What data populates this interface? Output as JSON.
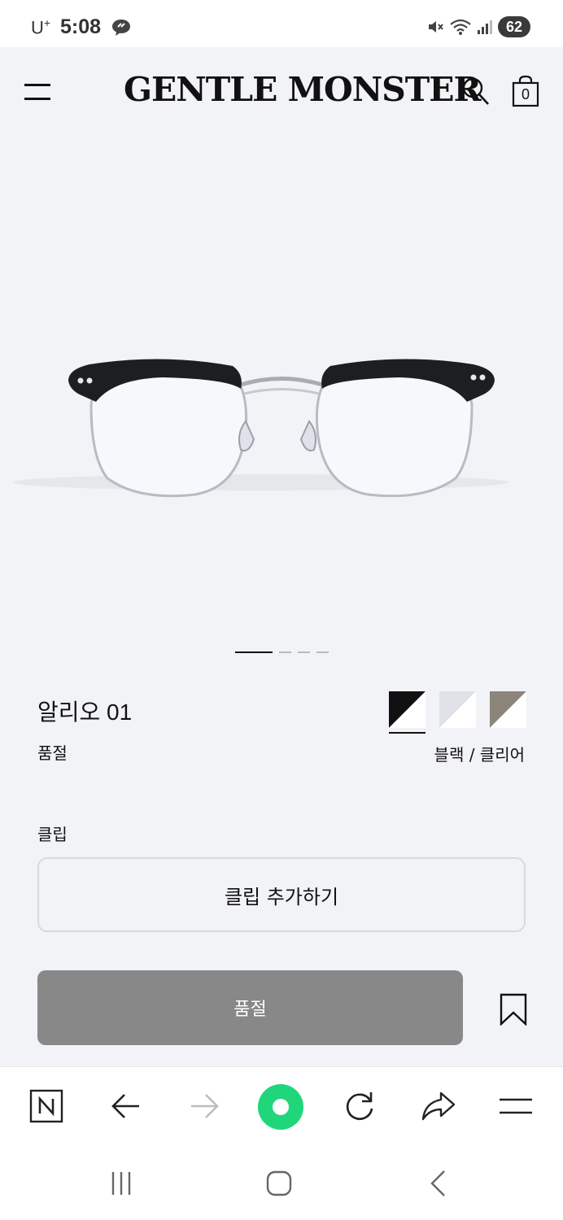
{
  "status_bar": {
    "carrier": "U",
    "carrier_sup": "+",
    "time": "5:08",
    "battery": "62"
  },
  "header": {
    "logo": "GENTLE MONSTER",
    "cart_count": "0"
  },
  "gallery": {
    "page_count": 4,
    "active_page": 1
  },
  "product": {
    "name": "알리오 01",
    "status": "품절",
    "color_name": "블랙 / 클리어",
    "swatches": [
      {
        "name": "black-clear",
        "colors": [
          "#111111",
          "#ffffff"
        ],
        "selected": true
      },
      {
        "name": "clear",
        "colors": [
          "#dfe1e6",
          "#ffffff"
        ],
        "selected": false
      },
      {
        "name": "grey-clear",
        "colors": [
          "#8b857c",
          "#ffffff"
        ],
        "selected": false
      }
    ]
  },
  "clip": {
    "label": "클립",
    "button_label": "클립 추가하기"
  },
  "purchase": {
    "soldout_label": "품절"
  },
  "colors": {
    "page_bg": "#f2f3f6",
    "soldout_bg": "#888888",
    "browser_accent": "#1fd77a"
  },
  "browser_toolbar": [
    "naver-home-icon",
    "back-icon",
    "forward-icon",
    "green-dot-icon",
    "refresh-icon",
    "share-icon",
    "menu-icon"
  ],
  "nav_bar": [
    "recent-apps-icon",
    "home-icon",
    "back-icon"
  ]
}
